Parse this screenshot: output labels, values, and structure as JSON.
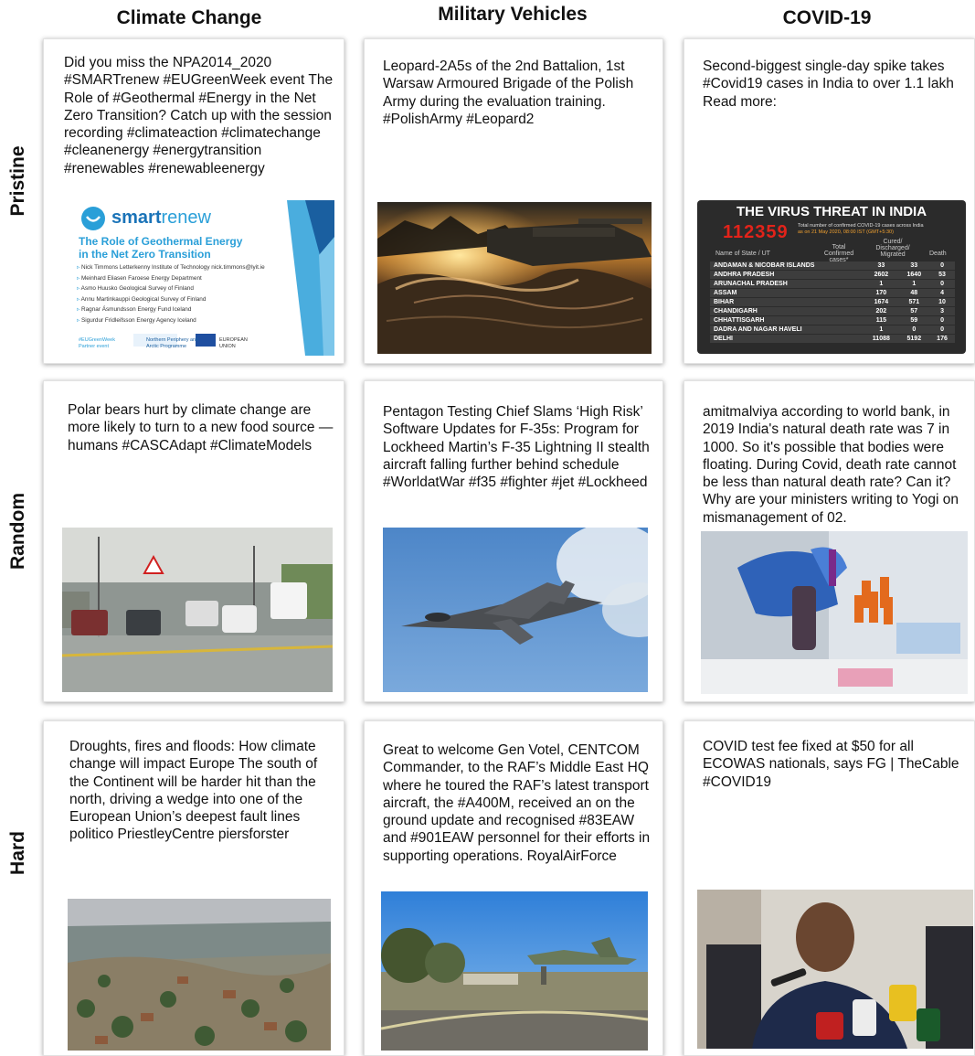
{
  "columns": [
    "Climate Change",
    "Military Vehicles",
    "COVID-19"
  ],
  "rows": [
    "Pristine",
    "Random",
    "Hard"
  ],
  "cards": {
    "pristine_climate": {
      "text": "Did you miss the  NPA2014_2020 #SMARTrenew #EUGreenWeek event The Role of #Geothermal #Energy in the Net Zero Transition? Catch up with the session recording #climateaction #climatechange #cleanenergy #energytransition  #renewables #renewableenergy",
      "image": "smartrenew-slide",
      "slide": {
        "logo_a": "smart",
        "logo_b": "renew",
        "title": "The Role of Geothermal Energy in the Net Zero Transition",
        "speakers": [
          "Nick Timmons Letterkenny Institute of Technology nick.timmons@lyit.ie",
          "Meinhard Eliasen Faroese Energy Department",
          "Asmo Huusko Geological Survey of Finland",
          "Annu Martinkauppi Geological Survey of Finland",
          "Ragnar Ásmundsson Energy Fund Iceland",
          "Sigurdur Fridleifsson Energy Agency Iceland"
        ],
        "footer": "#EUGreenWeek Partner event",
        "partner": "Northern Periphery and Arctic Programme",
        "eu": "EUROPEAN UNION"
      }
    },
    "pristine_military": {
      "text": "Leopard-2A5s of the 2nd Battalion, 1st Warsaw Armoured Brigade of the Polish Army during the evaluation training. #PolishArmy #Leopard2",
      "image": "tank-in-water-photo"
    },
    "pristine_covid": {
      "text": "Second-biggest single-day spike takes #Covid19 cases in India to over 1.1 lakh Read more:",
      "image": "india-virus-table",
      "table": {
        "title": "THE VIRUS THREAT IN INDIA",
        "total": "112359",
        "desc": "Total number of confirmed COVID-19 cases across India",
        "date": "as on 21 May 2020, 08:00 IST (GMT+5:30)",
        "col_state": "Name of State / UT",
        "col_confirmed": "Total Confirmed cases*",
        "col_cured": "Cured/ Discharged/ Migrated",
        "col_death": "Death",
        "rows": [
          [
            "ANDAMAN & NICOBAR ISLANDS",
            "33",
            "33",
            "0"
          ],
          [
            "ANDHRA PRADESH",
            "2602",
            "1640",
            "53"
          ],
          [
            "ARUNACHAL PRADESH",
            "1",
            "1",
            "0"
          ],
          [
            "ASSAM",
            "170",
            "48",
            "4"
          ],
          [
            "BIHAR",
            "1674",
            "571",
            "10"
          ],
          [
            "CHANDIGARH",
            "202",
            "57",
            "3"
          ],
          [
            "CHHATTISGARH",
            "115",
            "59",
            "0"
          ],
          [
            "DADRA AND NAGAR HAVELI",
            "1",
            "0",
            "0"
          ],
          [
            "DELHI",
            "11088",
            "5192",
            "176"
          ]
        ]
      }
    },
    "random_climate": {
      "text": "Polar bears hurt by climate change are more likely to turn to a new food source — humans #CASCAdapt #ClimateModels",
      "image": "flooded-highway-photo"
    },
    "random_military": {
      "text": "Pentagon Testing Chief Slams ‘High Risk’ Software Updates for F-35s: Program for Lockheed Martin’s F-35 Lightning II stealth aircraft falling further behind schedule #WorldatWar #f35 #fighter #jet #Lockheed",
      "image": "fighter-jet-photo"
    },
    "random_covid": {
      "text": "amitmalviya according to world bank, in 2019 India's natural death rate was 7 in 1000. So it's possible that bodies were floating.  During Covid, death rate cannot be less than natural death rate? Can it? Why are your ministers writing to Yogi on mismanagement of 02.",
      "image": "lab-pipette-photo"
    },
    "hard_climate": {
      "text": "Droughts, fires and floods: How climate change will impact Europe The south of the Continent will be harder hit than the north, driving a wedge into one of the European Union’s deepest fault lines politico PriestleyCentre piersforster",
      "image": "flooded-neighborhood-photo"
    },
    "hard_military": {
      "text": "Great to welcome Gen Votel, CENTCOM Commander, to the RAF’s Middle East HQ where he toured the RAF’s latest transport aircraft, the #A400M, received an on the ground update and recognised #83EAW and #901EAW personnel for their efforts in supporting operations. RoyalAirForce",
      "image": "airfield-monument-photo"
    },
    "hard_covid": {
      "text": "COVID test fee fixed at $50 for all ECOWAS nationals, says FG | TheCable #COVID19",
      "image": "press-conference-photo"
    }
  },
  "colors": {
    "slide_blue": "#2a9fd8",
    "table_bg": "#2b2b2b",
    "table_red": "#e2231a"
  }
}
